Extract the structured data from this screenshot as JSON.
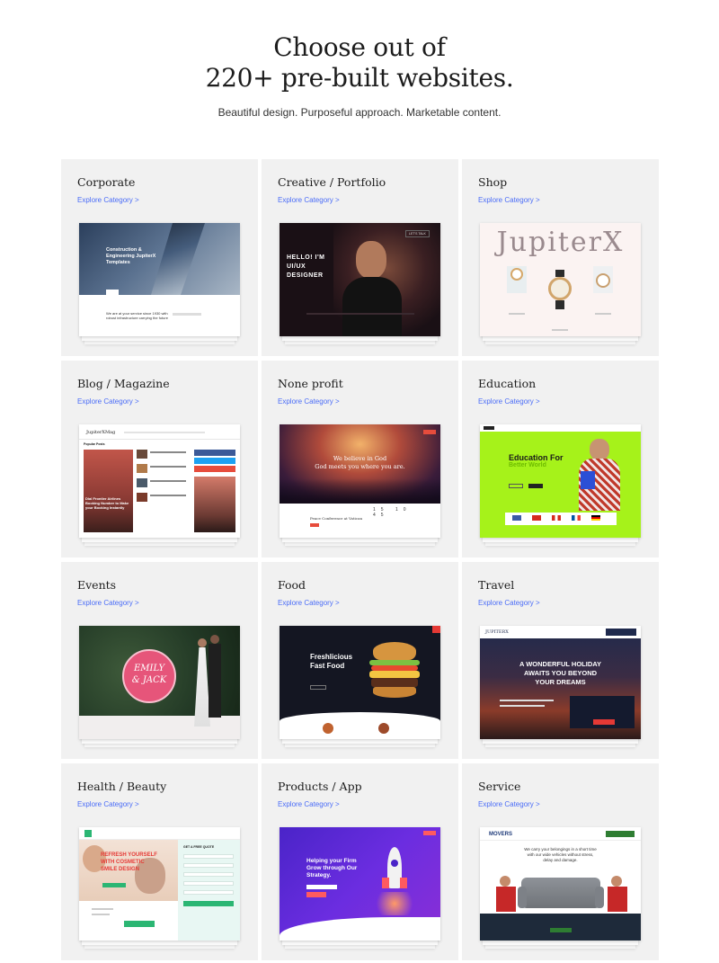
{
  "hero": {
    "title_line1": "Choose out of",
    "title_line2": "220+ pre-built websites.",
    "subtitle": "Beautiful design. Purposeful approach. Marketable content."
  },
  "categories": [
    {
      "title": "Corporate",
      "link": "Explore Category >",
      "preview": {
        "headline": "Construction & Engineering JupiterX Templates",
        "body": "We are at your service since 1930 with robust infrastructure carrying the future"
      }
    },
    {
      "title": "Creative / Portfolio",
      "link": "Explore Category >",
      "preview": {
        "headline": "HELLO! I'M UI/UX DESIGNER",
        "button": "LET'S TALK"
      }
    },
    {
      "title": "Shop",
      "link": "Explore Category >",
      "preview": {
        "brand": "JupiterX"
      }
    },
    {
      "title": "Blog / Magazine",
      "link": "Explore Category >",
      "preview": {
        "brand": "JupiterXMag",
        "section": "Popular Posts",
        "headline": "Dial Frontier Airlines Booking Number to Make your Booking Instantly"
      }
    },
    {
      "title": "None profit",
      "link": "Explore Category >",
      "preview": {
        "headline_line1": "We believe in God",
        "headline_line2": "God meets you where you are.",
        "event": "Peace Conference at Vatican"
      }
    },
    {
      "title": "Education",
      "link": "Explore Category >",
      "preview": {
        "headline_line1": "Education For",
        "headline_line2": "Better World"
      }
    },
    {
      "title": "Events",
      "link": "Explore Category >",
      "preview": {
        "names_line1": "EMILY",
        "names_line2": "& JACK"
      }
    },
    {
      "title": "Food",
      "link": "Explore Category >",
      "preview": {
        "headline_line1": "Freshlicious",
        "headline_line2": "Fast Food"
      }
    },
    {
      "title": "Travel",
      "link": "Explore Category >",
      "preview": {
        "brand": "JUPITERX",
        "headline_line1": "A WONDERFUL HOLIDAY",
        "headline_line2": "AWAITS YOU BEYOND",
        "headline_line3": "YOUR DREAMS"
      }
    },
    {
      "title": "Health / Beauty",
      "link": "Explore Category >",
      "preview": {
        "headline_line1": "REFRESH YOURSELF",
        "headline_line2": "WITH COSMETIC",
        "headline_line3": "SMILE DESIGN",
        "form_title": "GET A FREE QUOTE"
      }
    },
    {
      "title": "Products / App",
      "link": "Explore Category >",
      "preview": {
        "headline_line1": "Helping your Firm",
        "headline_line2": "Grow through Our",
        "headline_line3": "Strategy."
      }
    },
    {
      "title": "Service",
      "link": "Explore Category >",
      "preview": {
        "brand": "MOVERS",
        "headline_line1": "We carry your belongings in a short time",
        "headline_line2": "with our wide vehicles without stress,",
        "headline_line3": "delay and damage."
      }
    }
  ],
  "colors": {
    "card_bg": "#f1f1f1",
    "link": "#4a6cf7",
    "education_green": "#a6f21a",
    "food_dark": "#141622",
    "app_purple": "#6b2de0"
  }
}
